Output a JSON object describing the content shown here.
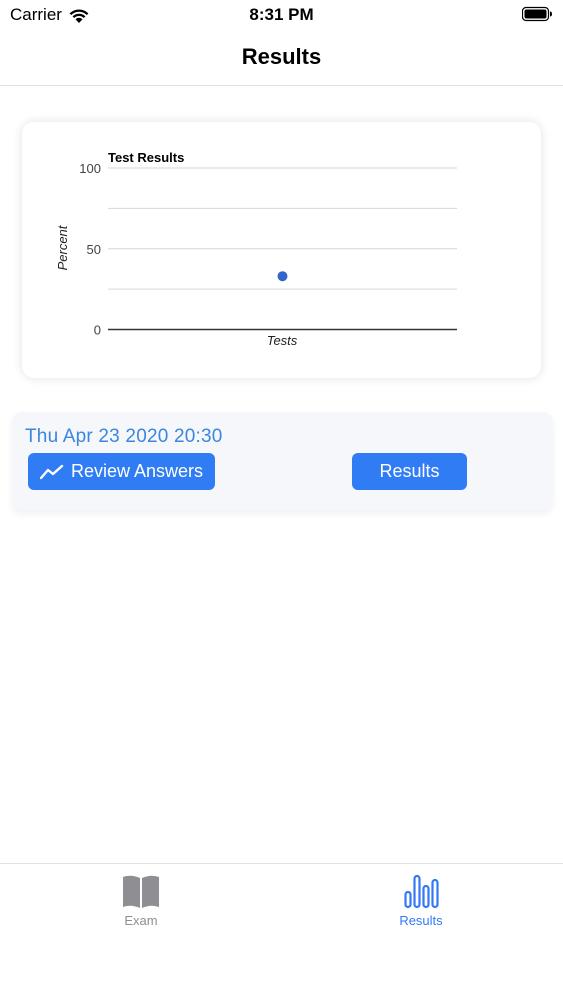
{
  "status_bar": {
    "carrier": "Carrier",
    "time": "8:31 PM"
  },
  "nav": {
    "title": "Results"
  },
  "chart_data": {
    "type": "scatter",
    "title": "Test Results",
    "xlabel": "Tests",
    "ylabel": "Percent",
    "ylim": [
      0,
      100
    ],
    "yticks": [
      0,
      50,
      100
    ],
    "grid": true,
    "points": [
      {
        "x": 1,
        "y": 33
      }
    ],
    "point_color": "#3366cc"
  },
  "result": {
    "date": "Thu Apr 23 2020 20:30",
    "review_label": "Review Answers",
    "results_label": "Results"
  },
  "tabs": [
    {
      "label": "Exam",
      "icon": "book-icon",
      "active": false
    },
    {
      "label": "Results",
      "icon": "bar-chart-icon",
      "active": true
    }
  ],
  "colors": {
    "accent": "#2f7cf5",
    "date_text": "#3b86e0",
    "tab_inactive": "#8e8e93",
    "tab_active": "#3478f6"
  }
}
